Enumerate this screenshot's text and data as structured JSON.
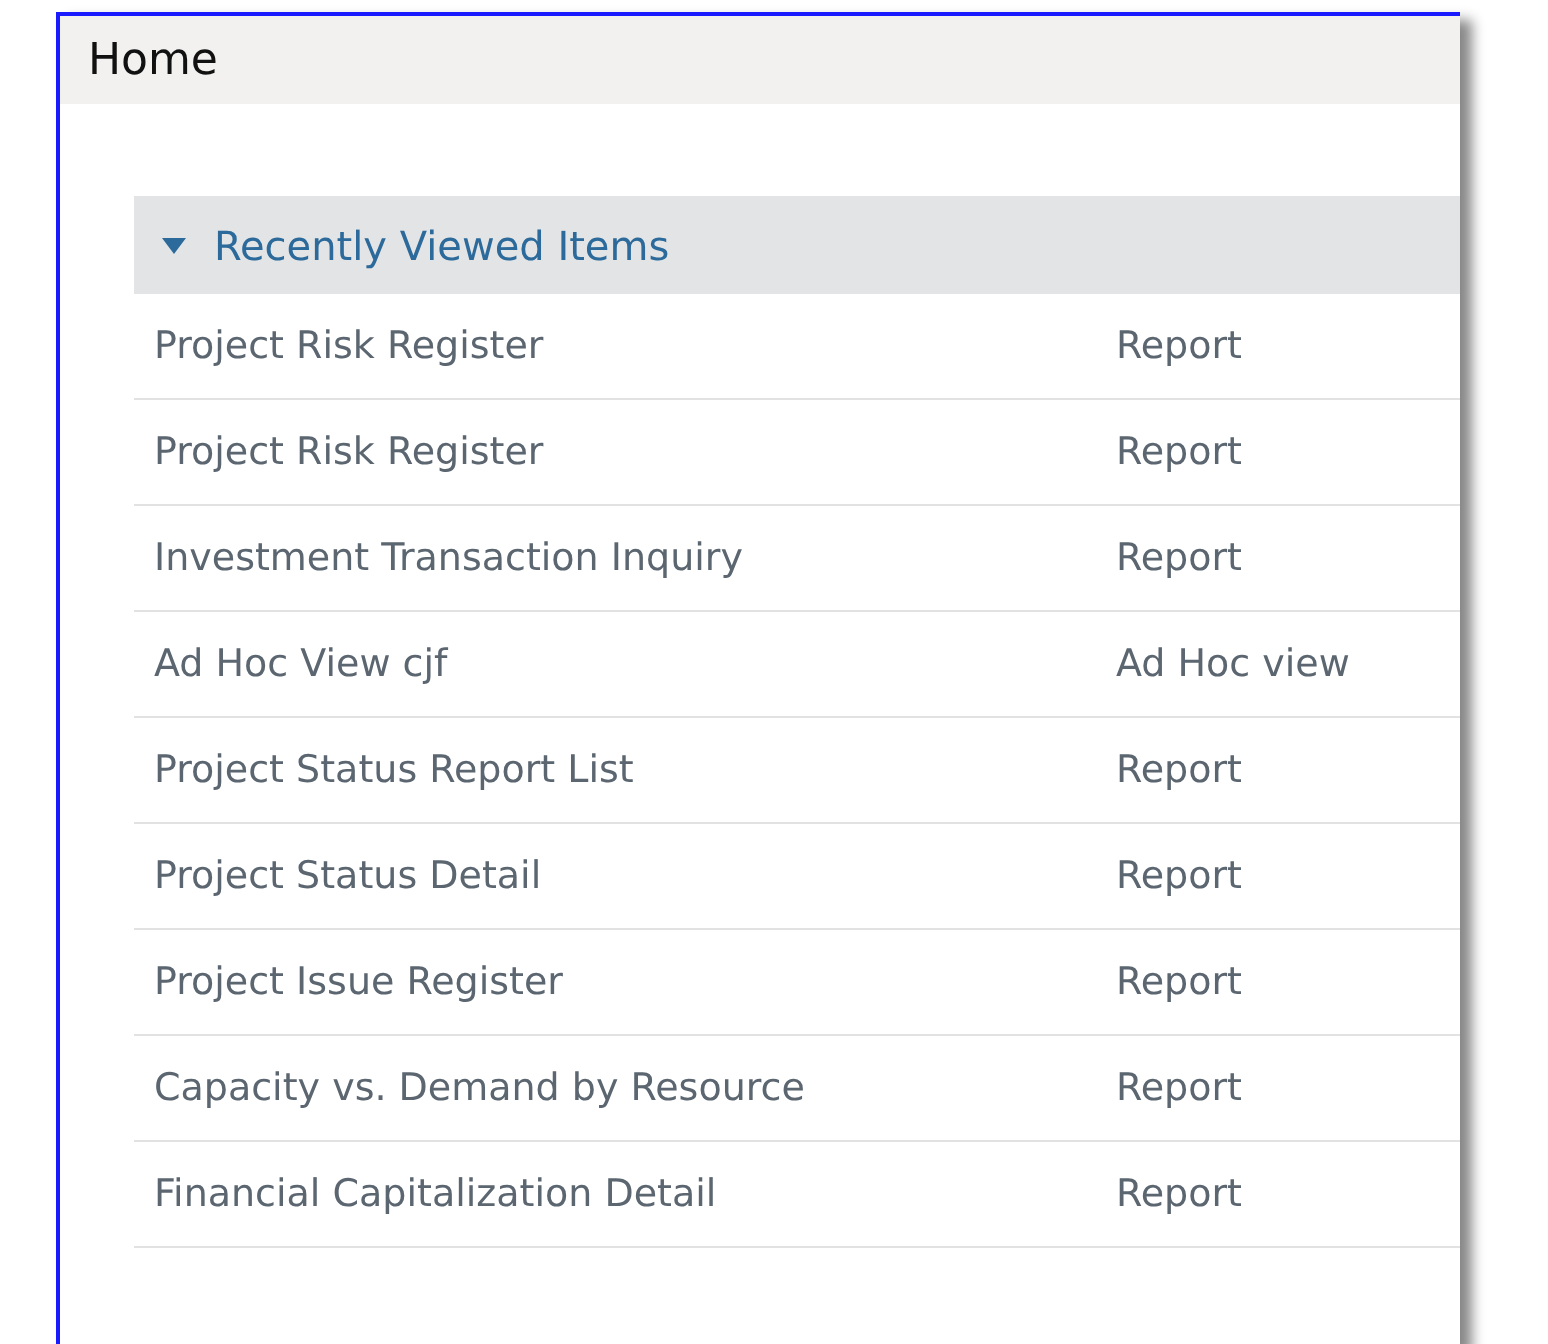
{
  "page": {
    "title": "Home"
  },
  "section": {
    "title": "Recently Viewed Items",
    "expanded": true,
    "rows": [
      {
        "name": "Project Risk Register",
        "type": "Report"
      },
      {
        "name": "Project Risk Register",
        "type": "Report"
      },
      {
        "name": "Investment Transaction Inquiry",
        "type": "Report"
      },
      {
        "name": "Ad Hoc View cjf",
        "type": "Ad Hoc view"
      },
      {
        "name": "Project Status Report List",
        "type": "Report"
      },
      {
        "name": "Project Status Detail",
        "type": "Report"
      },
      {
        "name": "Project Issue Register",
        "type": "Report"
      },
      {
        "name": "Capacity vs. Demand by Resource",
        "type": "Report"
      },
      {
        "name": "Financial Capitalization Detail",
        "type": "Report"
      }
    ]
  }
}
